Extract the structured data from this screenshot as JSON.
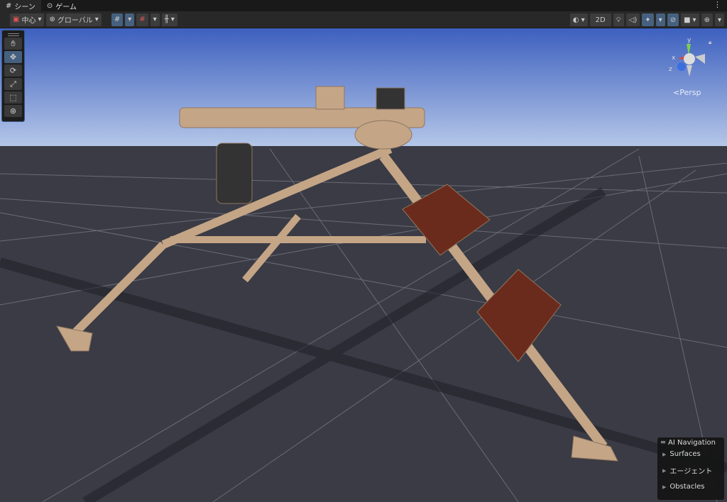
{
  "tabs": [
    {
      "label": "シーン",
      "icon": "grid-icon"
    },
    {
      "label": "ゲーム",
      "icon": "gamepad-icon"
    }
  ],
  "toolbar": {
    "pivot": "中心",
    "space": "グローバル",
    "mode_2d": "2D"
  },
  "gizmo": {
    "projection": "Persp",
    "axis_y": "y",
    "axis_x": "x",
    "axis_z": "z"
  },
  "ai_navigation": {
    "title": "AI Navigation",
    "items": [
      "Surfaces",
      "エージェント",
      "Obstacles"
    ]
  },
  "colors": {
    "sky_top": "#3d60bf",
    "sky_horizon": "#b4c6e8",
    "ground": "#3a3b44",
    "model": "#c4a586",
    "pad": "#6b2b1c"
  }
}
